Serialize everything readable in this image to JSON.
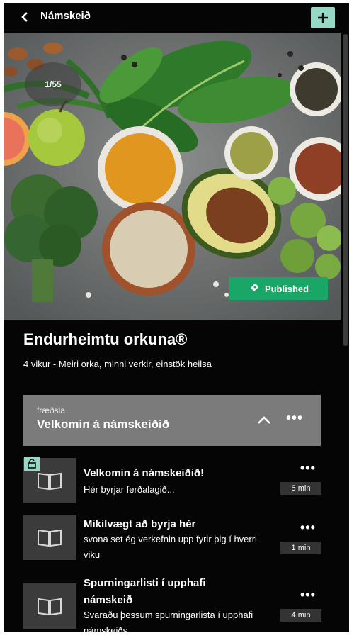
{
  "header": {
    "title": "Námskeið",
    "back_icon": "chevron-left-icon",
    "add_icon": "plus-icon",
    "add_color": "#97d7c5"
  },
  "hero": {
    "counter": "1/55",
    "status_label": "Published",
    "status_icon": "rocket-icon",
    "status_color": "#1aa666"
  },
  "course": {
    "title": "Endurheimtu orkuna®",
    "subtitle": "4 vikur - Meiri orka, minni verkir, einstök heilsa"
  },
  "section": {
    "label": "fræðsla",
    "title": "Velkomin á námskeiðið",
    "expand_icon": "chevron-up-icon",
    "more_icon": "more-icon"
  },
  "lessons": [
    {
      "title": "Velkomin á námskeiðið!",
      "description": "Hér byrjar ferðalagið...",
      "duration": "5 min",
      "icon": "book-icon",
      "unlocked": true
    },
    {
      "title": "Mikilvægt að byrja hér",
      "description": "svona set ég verkefnin upp fyrir þig í hverri viku",
      "duration": "1 min",
      "icon": "book-icon"
    },
    {
      "title": "Spurningarlisti í upphafi námskeið",
      "description": "Svaraðu þessum spurningarlista í upphafi námskeiðs",
      "duration": "4 min",
      "icon": "book-icon"
    }
  ]
}
